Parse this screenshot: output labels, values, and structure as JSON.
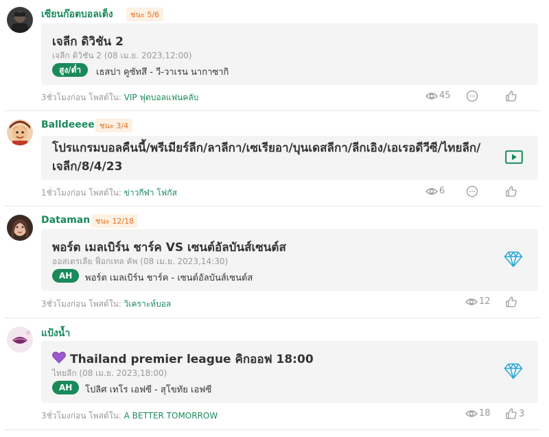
{
  "posts": [
    {
      "username": "เซียนก๊อตบอลเต็ง",
      "badge": "ชนะ 5/6",
      "title": "เจลีก ดิวิชัน 2",
      "subtitle": "เจลีก ดิวิชัน 2 (08 เม.ย. 2023,12:00)",
      "tag": "สูง/ต่ำ",
      "teams": "เธสปา คูซัทสึ - วี-วาเรน นากาซากิ",
      "time": "3ชั่วโมงก่อน",
      "posted_in_label": "โพสต์ใน:",
      "posted_in": "VIP ฟุตบอลแฟนคลับ",
      "views": "45",
      "right_icon": "none",
      "has_comment": true,
      "likes": ""
    },
    {
      "username": "Balldeeee",
      "badge": "ชนะ 3/4",
      "title": "โปรแกรมบอลคืนนี้/พรีเมียร์ลีก/ลาลีกา/เซเรียอา/บุนเดสลีกา/ลีกเอิง/เอเรอดีวีซี/ไทยลีก/เจลีก/8/4/23",
      "time": "1ชั่วโมงก่อน",
      "posted_in_label": "โพสต์ใน:",
      "posted_in": "ข่าวกีฬา โฟกัส",
      "views": "6",
      "right_icon": "video-play-icon",
      "has_comment": true,
      "likes": ""
    },
    {
      "username": "Dataman",
      "badge": "ชนะ 12/18",
      "title": "พอร์ต เมลเบิร์น ชาร์ค VS เซนต์อัลบันส์เซนต์ส",
      "subtitle": "ออสเตรเลีย ฟ็อกเทล คัพ (08 เม.ย. 2023,14:30)",
      "tag": "AH",
      "teams": "พอร์ต เมลเบิร์น ชาร์ค - เซนต์อัลบันส์เซนต์ส",
      "time": "3ชั่วโมงก่อน",
      "posted_in_label": "โพสต์ใน:",
      "posted_in": "วิเคราะห์บอล",
      "views": "12",
      "right_icon": "diamond-icon",
      "has_comment": false,
      "likes": ""
    },
    {
      "username": "แป้งน้ำ",
      "badge": "",
      "title": "Thailand premier league คิกออฟ 18:00",
      "title_emoji": "purple-heart-icon",
      "subtitle": "ไทยลีก (08 เม.ย. 2023,18:00)",
      "tag": "AH",
      "teams": "โปลิศ เทโร เอฟซี - สุโขทัย เอฟซี",
      "time": "3ชั่วโมงก่อน",
      "posted_in_label": "โพสต์ใน:",
      "posted_in": "A BETTER TOMORROW",
      "views": "18",
      "right_icon": "diamond-icon",
      "has_comment": false,
      "likes": "3"
    }
  ],
  "colors": {
    "accent": "#1a8a5a",
    "badge_text": "#e07020",
    "badge_bg": "#fdf1e4",
    "card_bg": "#f4f4f4",
    "diamond": "#29a9d8"
  }
}
